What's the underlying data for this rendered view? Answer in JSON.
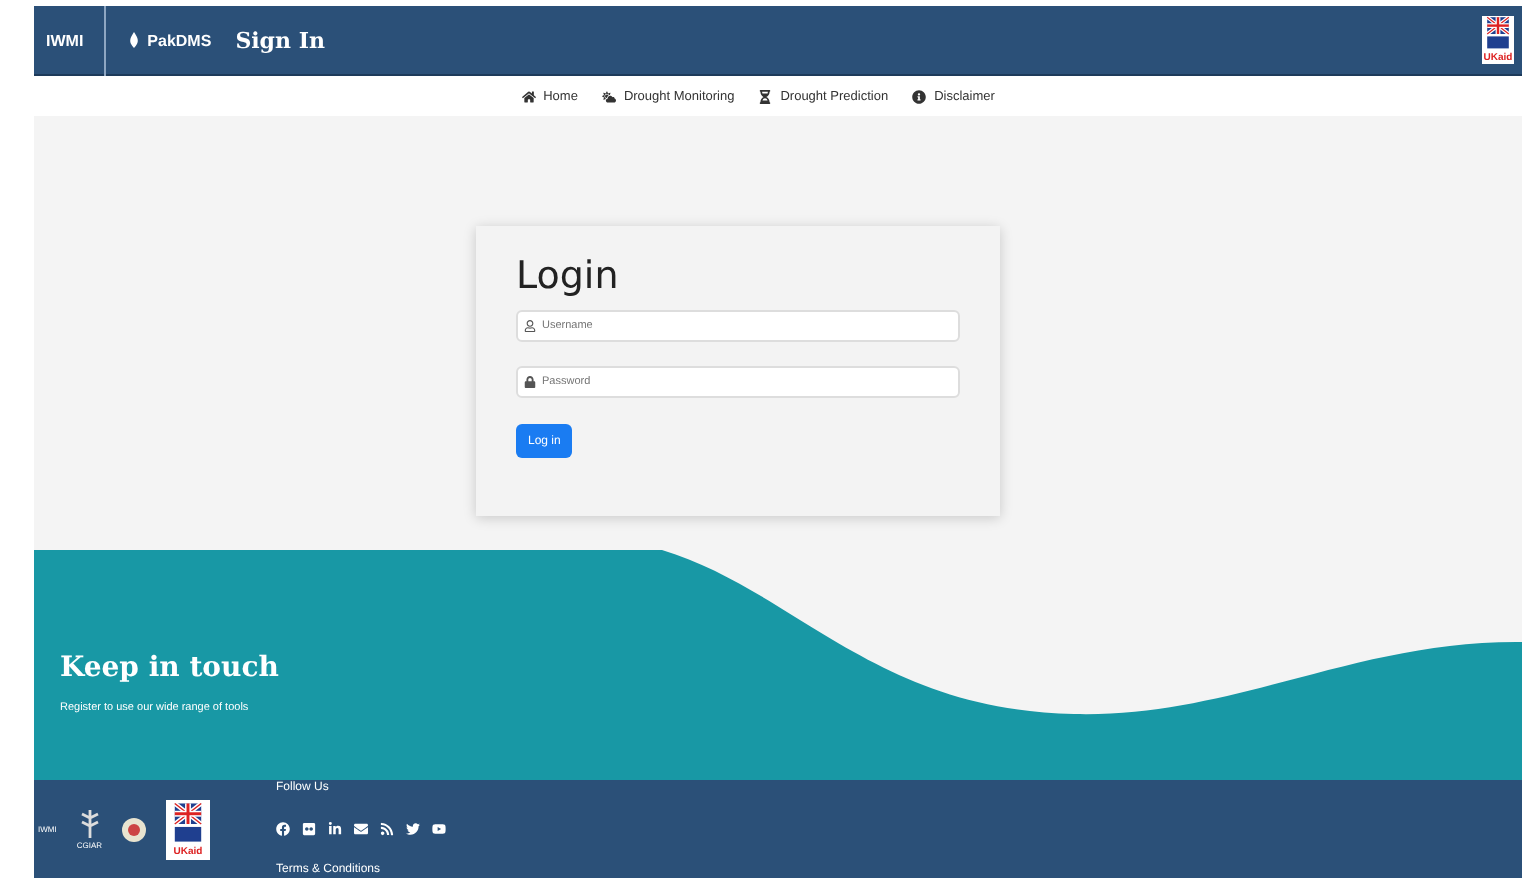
{
  "header": {
    "logos": [
      "IWMI",
      "PakDMS"
    ],
    "title": "Sign In",
    "partner_logo": "UKaid"
  },
  "nav": [
    {
      "label": "Home",
      "kind": "home"
    },
    {
      "label": "Drought Monitoring",
      "kind": "monitoring"
    },
    {
      "label": "Drought Prediction",
      "kind": "prediction"
    },
    {
      "label": "Disclaimer",
      "kind": "info"
    }
  ],
  "login": {
    "title": "Login",
    "fields": [
      {
        "kind": "user",
        "placeholder": "Username"
      },
      {
        "kind": "lock",
        "placeholder": "Password"
      }
    ],
    "button": "Log in"
  },
  "keep_in_touch": {
    "title": "Keep in touch",
    "text": "Register to use our wide range of tools"
  },
  "footer": {
    "logos": [
      {
        "kind": "iwmi",
        "label": "IWMI"
      },
      {
        "kind": "cgiar",
        "label": "CGIAR"
      },
      {
        "kind": "seal"
      },
      {
        "kind": "ukaid",
        "label": "UKaid"
      }
    ],
    "follow": "Follow Us",
    "social": [
      {
        "kind": "facebook"
      },
      {
        "kind": "flickr"
      },
      {
        "kind": "linkedin"
      },
      {
        "kind": "email"
      },
      {
        "kind": "rss"
      },
      {
        "kind": "twitter"
      },
      {
        "kind": "youtube"
      }
    ],
    "terms": "Terms & Conditions"
  }
}
